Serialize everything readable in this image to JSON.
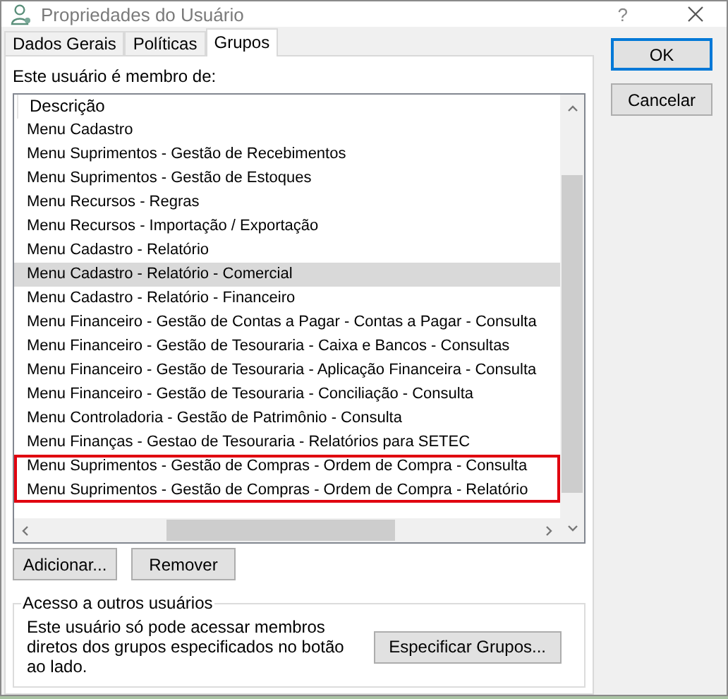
{
  "window": {
    "title": "Propriedades do Usuário",
    "help": "?"
  },
  "tabs": [
    {
      "label": "Dados Gerais",
      "selected": false
    },
    {
      "label": "Políticas",
      "selected": false
    },
    {
      "label": "Grupos",
      "selected": true
    }
  ],
  "members_label": "Este usuário é membro de:",
  "list": {
    "header": "Descrição",
    "rows": [
      {
        "text": "Menu Cadastro",
        "selected": false,
        "flagged": false
      },
      {
        "text": "Menu Suprimentos - Gestão de Recebimentos",
        "selected": false,
        "flagged": false
      },
      {
        "text": "Menu Suprimentos - Gestão de Estoques",
        "selected": false,
        "flagged": false
      },
      {
        "text": "Menu Recursos - Regras",
        "selected": false,
        "flagged": false
      },
      {
        "text": "Menu Recursos - Importação / Exportação",
        "selected": false,
        "flagged": false
      },
      {
        "text": "Menu Cadastro - Relatório",
        "selected": false,
        "flagged": false
      },
      {
        "text": "Menu Cadastro - Relatório - Comercial",
        "selected": true,
        "flagged": false
      },
      {
        "text": "Menu Cadastro - Relatório - Financeiro",
        "selected": false,
        "flagged": false
      },
      {
        "text": "Menu Financeiro - Gestão de Contas a Pagar - Contas a Pagar - Consulta",
        "selected": false,
        "flagged": false
      },
      {
        "text": "Menu Financeiro - Gestão de Tesouraria - Caixa e Bancos - Consultas",
        "selected": false,
        "flagged": false
      },
      {
        "text": "Menu Financeiro - Gestão de Tesouraria - Aplicação Financeira - Consulta",
        "selected": false,
        "flagged": false
      },
      {
        "text": "Menu Financeiro - Gestão de Tesouraria - Conciliação - Consulta",
        "selected": false,
        "flagged": false
      },
      {
        "text": "Menu Controladoria - Gestão de Patrimônio - Consulta",
        "selected": false,
        "flagged": false
      },
      {
        "text": "Menu Finanças - Gestao de Tesouraria - Relatórios para SETEC",
        "selected": false,
        "flagged": false
      },
      {
        "text": "Menu Suprimentos - Gestão de Compras - Ordem de Compra - Consulta",
        "selected": false,
        "flagged": true
      },
      {
        "text": "Menu Suprimentos - Gestão de Compras - Ordem de Compra - Relatório",
        "selected": false,
        "flagged": true
      }
    ]
  },
  "list_buttons": [
    "Adicionar...",
    "Remover"
  ],
  "access_group": {
    "title": "Acesso a outros usuários",
    "text": "Este usuário só pode acessar membros diretos dos grupos especificados no botão ao lado.",
    "button": "Especificar Grupos..."
  },
  "dialog_buttons": [
    {
      "label": "OK",
      "default": true
    },
    {
      "label": "Cancelar",
      "default": false
    }
  ]
}
